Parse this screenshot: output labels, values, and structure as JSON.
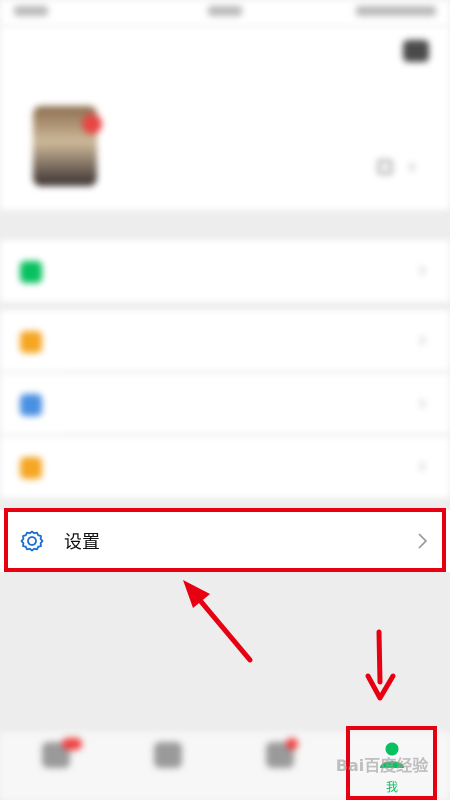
{
  "status_bar": {
    "time": "",
    "carrier": "",
    "icons": ""
  },
  "profile": {
    "camera_icon": "camera-icon",
    "nickname": "",
    "wechat_id": "",
    "qr_icon": "qr-code-icon",
    "chevron": "›"
  },
  "menu": {
    "items": [
      {
        "icon": "wallet-icon",
        "label": "",
        "color": "#07c160"
      },
      {
        "icon": "favorites-icon",
        "label": "",
        "color": "#f5a623"
      },
      {
        "icon": "album-icon",
        "label": "",
        "color": "#4a90e2"
      },
      {
        "icon": "cards-icon",
        "label": "",
        "color": "#f5a623"
      }
    ],
    "chevron": "›"
  },
  "settings": {
    "label": "设置",
    "icon": "gear-icon",
    "icon_color": "#1a6fd1"
  },
  "annotations": {
    "highlight_color": "#e60012"
  },
  "tabbar": {
    "tabs": [
      {
        "label": "",
        "icon": "chat-icon"
      },
      {
        "label": "",
        "icon": "contacts-icon"
      },
      {
        "label": "",
        "icon": "discover-icon"
      },
      {
        "label": "我",
        "icon": "me-icon",
        "active": true,
        "color": "#07c160"
      }
    ]
  },
  "watermark": {
    "text": "Bai百度经验"
  }
}
